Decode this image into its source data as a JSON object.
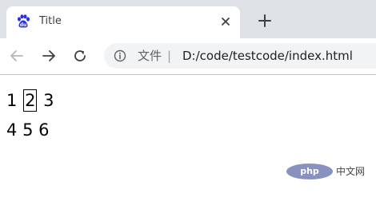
{
  "tab": {
    "title": "Title",
    "favicon": "baidu-paw-icon"
  },
  "toolbar": {
    "icons": {
      "back": "arrow-left-icon",
      "forward": "arrow-right-icon",
      "reload": "reload-icon",
      "info": "info-icon",
      "close": "close-icon",
      "new_tab": "plus-icon"
    }
  },
  "omnibox": {
    "scheme_label": "文件",
    "separator": "|",
    "url": "D:/code/testcode/index.html"
  },
  "page": {
    "rows": [
      [
        "1",
        "2",
        "3"
      ],
      [
        "4",
        "5",
        "6"
      ]
    ],
    "boxed_item": "2"
  },
  "watermark": {
    "logo": "php",
    "text": "中文网"
  },
  "colors": {
    "tabstrip": "#dee1e6",
    "omnibox": "#f1f3f4",
    "favicon": "#2932e1",
    "watermark_logo": "#8892bf"
  }
}
